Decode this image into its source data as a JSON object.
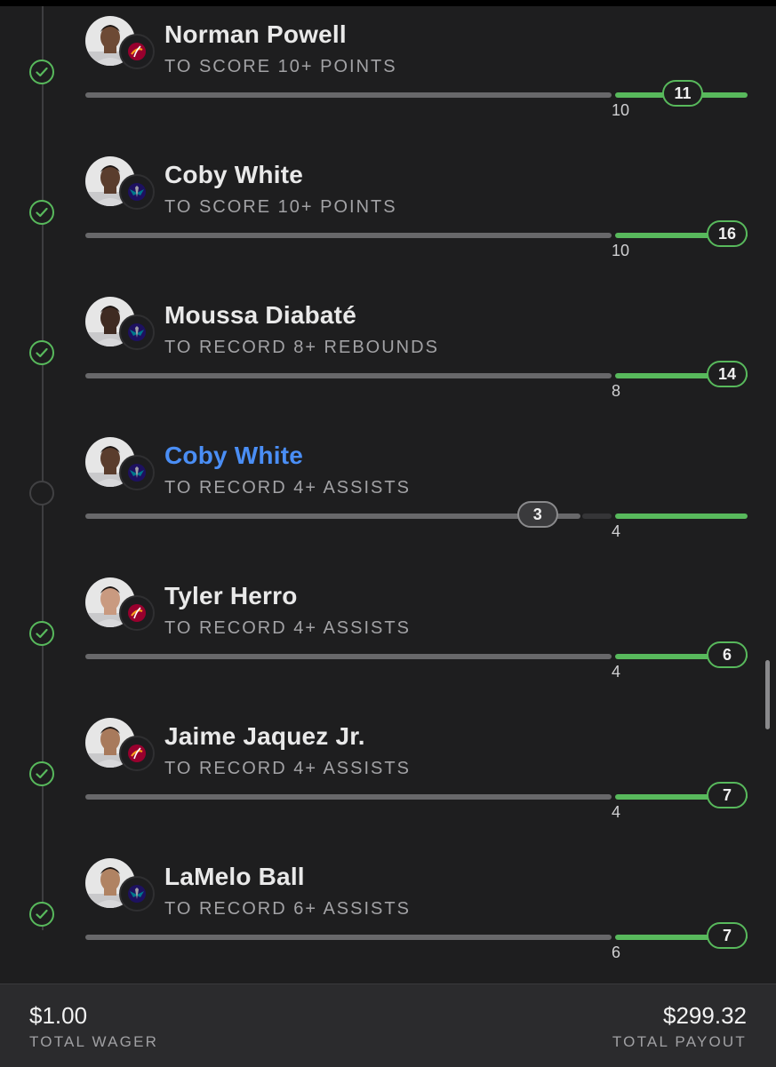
{
  "legs": [
    {
      "player": "Norman Powell",
      "description": "TO SCORE 10+ POINTS",
      "status": "won",
      "team": "heat",
      "avatar_tone": "#6d4a35",
      "threshold": "10",
      "current": "11",
      "progress_pct": 100,
      "active": false
    },
    {
      "player": "Coby White",
      "description": "TO SCORE 10+ POINTS",
      "status": "won",
      "team": "hornets",
      "avatar_tone": "#5a3d2d",
      "threshold": "10",
      "current": "16",
      "progress_pct": 100,
      "active": false
    },
    {
      "player": "Moussa Diabaté",
      "description": "TO RECORD 8+ REBOUNDS",
      "status": "won",
      "team": "hornets",
      "avatar_tone": "#3f2b22",
      "threshold": "8",
      "current": "14",
      "progress_pct": 100,
      "active": false
    },
    {
      "player": "Coby White",
      "description": "TO RECORD 4+ ASSISTS",
      "status": "pending",
      "team": "hornets",
      "avatar_tone": "#5a3d2d",
      "threshold": "4",
      "current": "3",
      "progress_pct": 75,
      "active": true
    },
    {
      "player": "Tyler Herro",
      "description": "TO RECORD 4+ ASSISTS",
      "status": "won",
      "team": "heat",
      "avatar_tone": "#c99a80",
      "threshold": "4",
      "current": "6",
      "progress_pct": 100,
      "active": false
    },
    {
      "player": "Jaime Jaquez Jr.",
      "description": "TO RECORD 4+ ASSISTS",
      "status": "won",
      "team": "heat",
      "avatar_tone": "#a87a5c",
      "threshold": "4",
      "current": "7",
      "progress_pct": 100,
      "active": false
    },
    {
      "player": "LaMelo Ball",
      "description": "TO RECORD 6+ ASSISTS",
      "status": "won",
      "team": "hornets",
      "avatar_tone": "#b08363",
      "threshold": "6",
      "current": "7",
      "progress_pct": 100,
      "active": false
    }
  ],
  "footer": {
    "wager_amount": "$1.00",
    "wager_label": "TOTAL WAGER",
    "payout_amount": "$299.32",
    "payout_label": "TOTAL PAYOUT"
  },
  "colors": {
    "win": "#58b95c",
    "active_name": "#4a8ef5",
    "heat": "#98002e",
    "hornets": "#1d1160"
  },
  "icons": {
    "status_won": "check-circle-icon",
    "status_pending": "empty-circle-icon",
    "heat": "heat-logo-icon",
    "hornets": "hornets-logo-icon"
  }
}
